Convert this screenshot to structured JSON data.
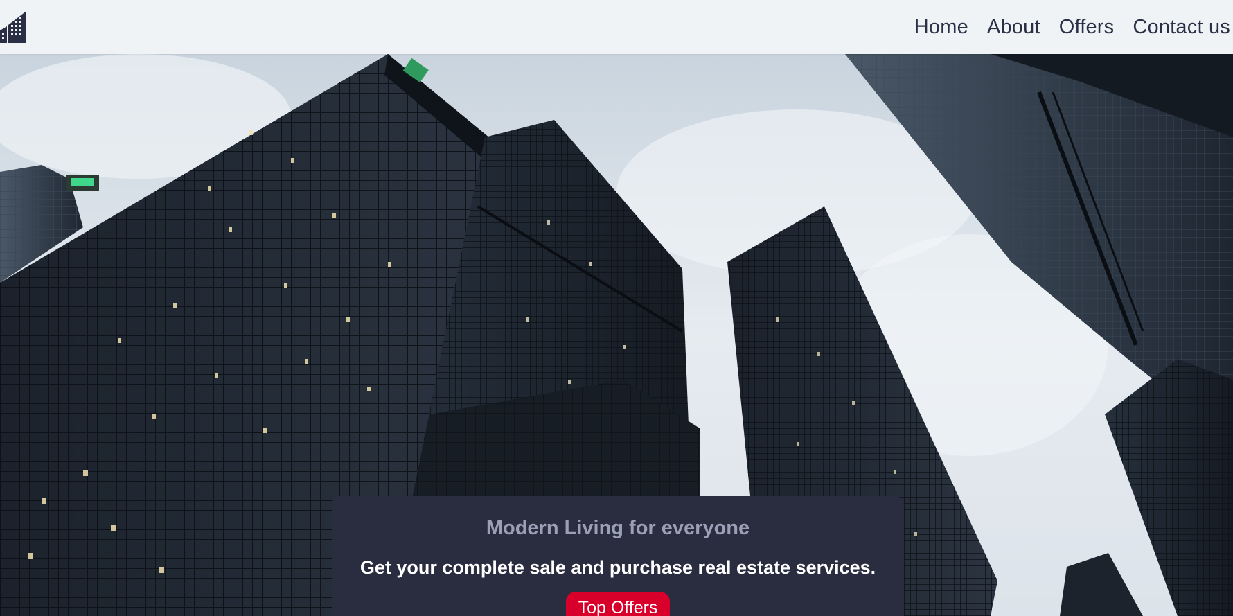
{
  "navbar": {
    "logo_icon": "building-icon",
    "links": [
      "Home",
      "About",
      "Offers",
      "Contact us"
    ]
  },
  "hero": {
    "background": "low-angle photo of glass office skyscrapers against a cloudy sky",
    "heading": "Modern Living for everyone",
    "subheading": "Get your complete sale and purchase real estate services.",
    "cta_label": "Top Offers"
  },
  "colors": {
    "navbar_bg": "#eff3f6",
    "nav_text": "#2b2f45",
    "card_bg": "#2a2c40",
    "heading_text": "#9aa0b5",
    "cta_bg": "#d8002b"
  }
}
